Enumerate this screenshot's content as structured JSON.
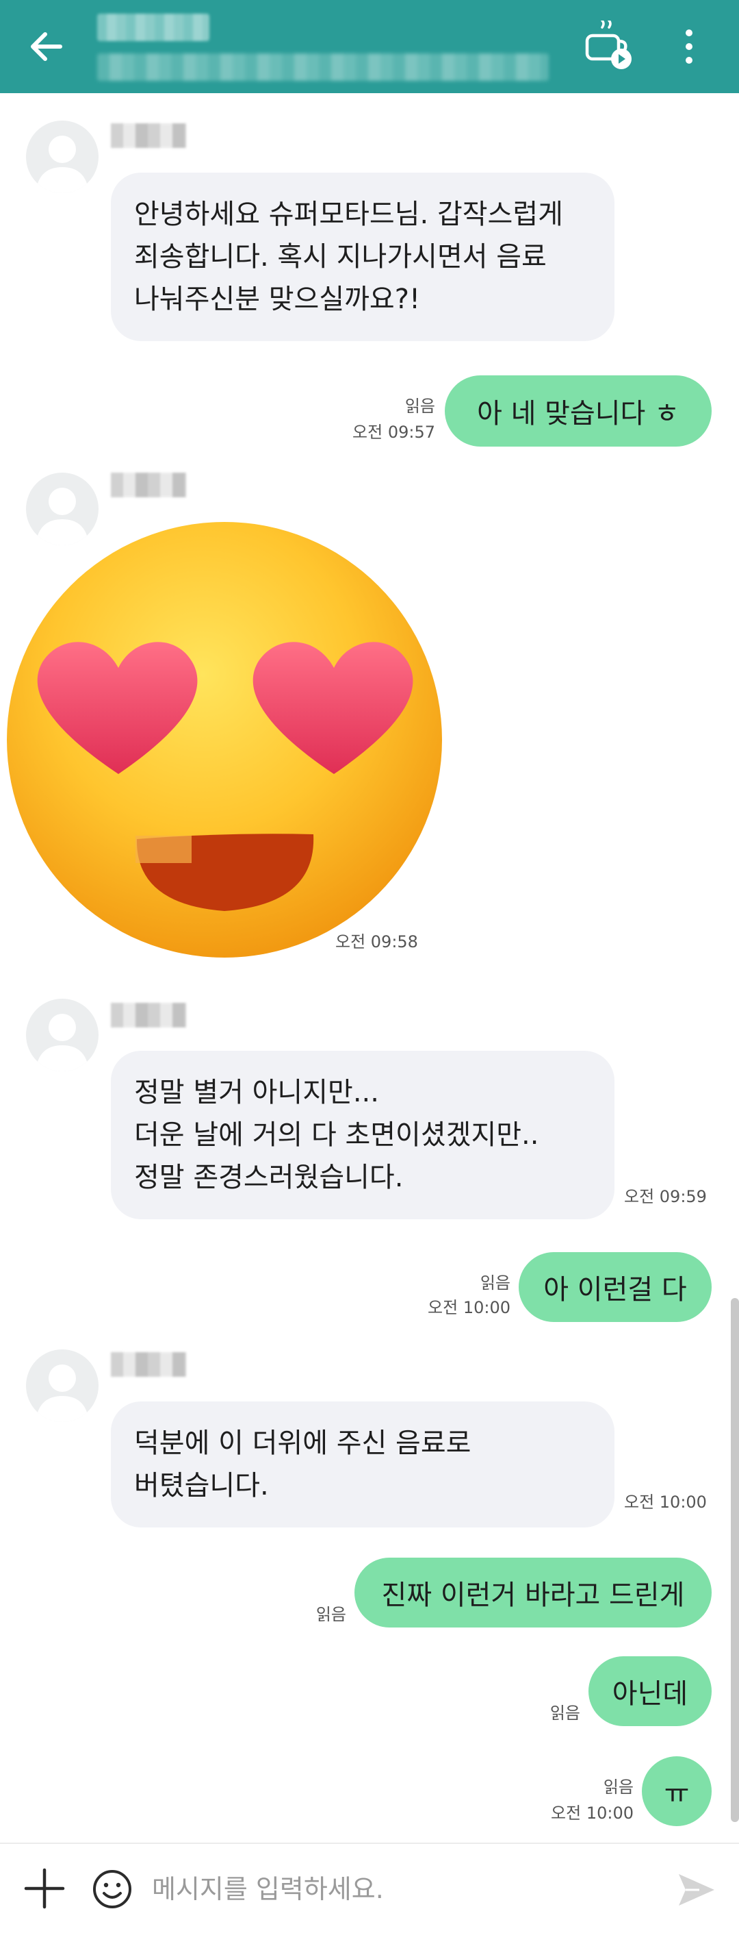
{
  "header": {
    "back_icon": "arrow-left-icon",
    "action_icon": "coffee-cup-play-icon",
    "menu_icon": "more-vertical-icon",
    "background_color": "#2a9c97"
  },
  "messages": [
    {
      "direction": "incoming",
      "lines": [
        "안녕하세요 슈퍼모타드님. 갑작스럽게",
        "죄송합니다. 혹시 지나가시면서 음료",
        "나눠주신분 맞으실까요?!"
      ]
    },
    {
      "direction": "outgoing",
      "text": "아 네 맞습니다  ㅎ",
      "read": "읽음",
      "time": "오전 09:57"
    },
    {
      "direction": "incoming",
      "type": "emoji",
      "emoji": "smiling-face-with-heart-eyes",
      "time": "오전 09:58"
    },
    {
      "direction": "incoming",
      "lines": [
        "정말 별거 아니지만...",
        "더운 날에 거의 다 초면이셨겠지만..",
        "정말 존경스러웠습니다."
      ],
      "time": "오전 09:59"
    },
    {
      "direction": "outgoing",
      "text": "아 이런걸 다",
      "read": "읽음",
      "time": "오전 10:00"
    },
    {
      "direction": "incoming",
      "lines": [
        "덕분에 이 더위에 주신 음료로",
        "버텼습니다."
      ],
      "time": "오전 10:00"
    },
    {
      "direction": "outgoing",
      "text": "진짜 이런거 바라고 드린게",
      "read": "읽음"
    },
    {
      "direction": "outgoing",
      "text": "아닌데",
      "read": "읽음"
    },
    {
      "direction": "outgoing",
      "text": "ㅠ",
      "read": "읽음",
      "time": "오전 10:00"
    }
  ],
  "input": {
    "placeholder": "메시지를 입력하세요.",
    "plus_icon": "plus-icon",
    "emoji_icon": "smiley-icon",
    "send_icon": "send-icon"
  },
  "colors": {
    "outgoing_bubble": "#7fe0a8",
    "incoming_bubble": "#f1f2f6"
  }
}
